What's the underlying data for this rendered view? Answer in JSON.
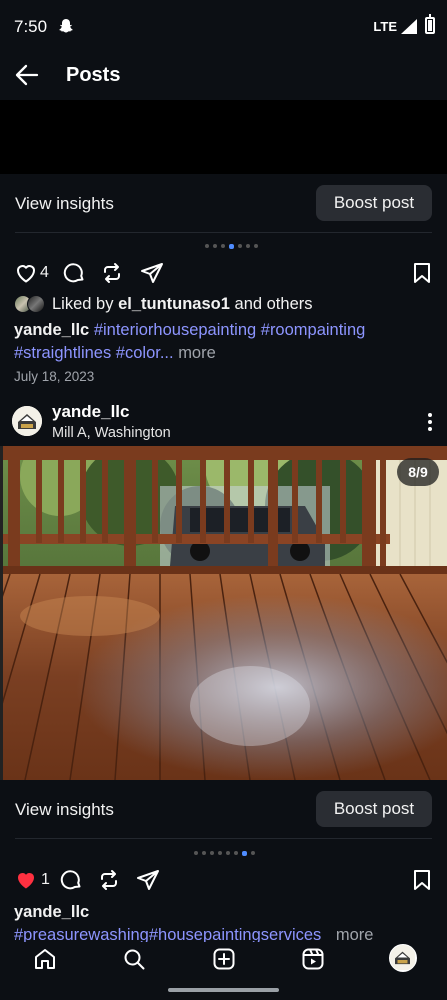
{
  "status_bar": {
    "time": "7:50",
    "network": "LTE"
  },
  "header": {
    "title": "Posts"
  },
  "post1": {
    "view_insights": "View insights",
    "boost_post": "Boost post",
    "likes": "4",
    "liked_by_prefix": "Liked by",
    "liked_by_user": "el_tuntunaso1",
    "liked_by_suffix": "and others",
    "caption_user": "yande_llc",
    "caption_tags_line1": "#interiorhousepainting #roompainting",
    "caption_tags_line2": "#straightlines #color...",
    "caption_more": "more",
    "date": "July 18, 2023"
  },
  "post2": {
    "username": "yande_llc",
    "location": "Mill A, Washington",
    "image_counter": "8/9",
    "view_insights": "View insights",
    "boost_post": "Boost post",
    "likes": "1",
    "caption_user": "yande_llc",
    "caption_tags": "#preasurewashing#housepaintingservices",
    "caption_more": "more"
  },
  "colors": {
    "background": "#0c0f14",
    "hashtag": "#8d95ff",
    "dot_active": "#4f8cff",
    "heart_liked": "#ff3040"
  },
  "icons": [
    "heart-icon",
    "comment-icon",
    "repost-icon",
    "share-icon",
    "bookmark-icon",
    "home-icon",
    "search-icon",
    "create-icon",
    "reels-icon"
  ]
}
